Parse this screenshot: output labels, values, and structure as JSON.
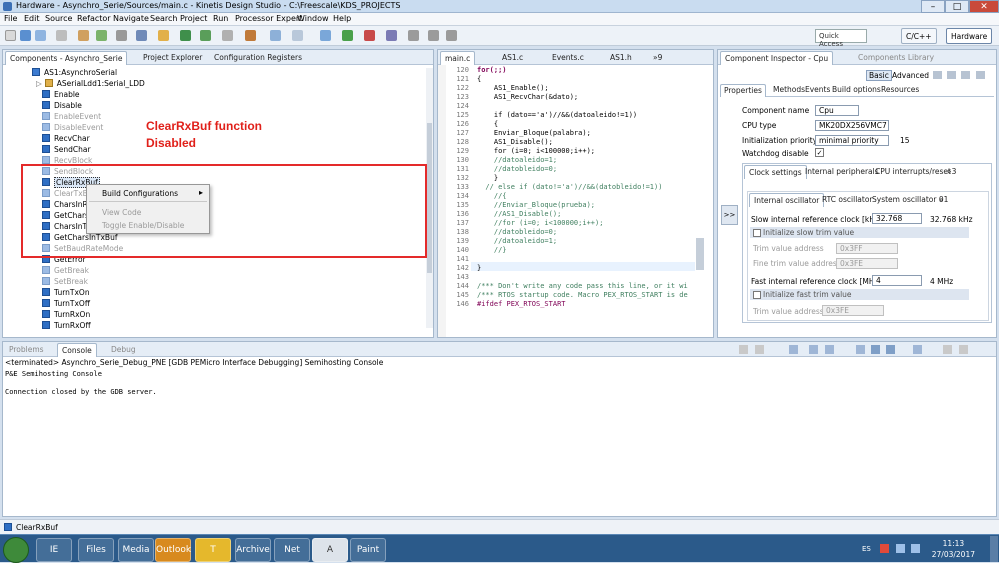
{
  "window": {
    "title": "Hardware - Asynchro_Serie/Sources/main.c - Kinetis Design Studio - C:\\Freescale\\KDS_PROJECTS",
    "min": "–",
    "max": "□",
    "close": "✕"
  },
  "menu": [
    "File",
    "Edit",
    "Source",
    "Refactor",
    "Navigate",
    "Search",
    "Project",
    "Run",
    "Processor Expert",
    "Window",
    "Help"
  ],
  "toolbar": {
    "quick_access": "Quick Access",
    "persp_cpp": "C/C++",
    "persp_hw": "Hardware"
  },
  "left_pane": {
    "tabs": [
      "Components - Asynchro_Serie",
      "Project Explorer",
      "Configuration Registers"
    ],
    "tree": [
      {
        "label": "AS1:AsynchroSerial",
        "state": "root"
      },
      {
        "label": "ASerialLdd1:Serial_LDD",
        "state": "child"
      },
      {
        "label": "Enable",
        "state": "on"
      },
      {
        "label": "Disable",
        "state": "on"
      },
      {
        "label": "EnableEvent",
        "state": "off"
      },
      {
        "label": "DisableEvent",
        "state": "off"
      },
      {
        "label": "RecvChar",
        "state": "on"
      },
      {
        "label": "SendChar",
        "state": "on"
      },
      {
        "label": "RecvBlock",
        "state": "off"
      },
      {
        "label": "SendBlock",
        "state": "off"
      },
      {
        "label": "ClearRxBuf",
        "state": "selected"
      },
      {
        "label": "ClearTxBuf",
        "state": "off"
      },
      {
        "label": "CharsInRxBuf",
        "state": "on"
      },
      {
        "label": "GetCharsInRxBuf",
        "state": "on"
      },
      {
        "label": "CharsInTxBuf",
        "state": "on"
      },
      {
        "label": "GetCharsInTxBuf",
        "state": "on"
      },
      {
        "label": "SetBaudRateMode",
        "state": "off"
      },
      {
        "label": "GetError",
        "state": "on"
      },
      {
        "label": "GetBreak",
        "state": "off"
      },
      {
        "label": "SetBreak",
        "state": "off"
      },
      {
        "label": "TurnTxOn",
        "state": "on"
      },
      {
        "label": "TurnTxOff",
        "state": "on"
      },
      {
        "label": "TurnRxOn",
        "state": "on"
      },
      {
        "label": "TurnRxOff",
        "state": "on"
      }
    ],
    "annotation_line1": "ClearRxBuf function",
    "annotation_line2": "Disabled",
    "context_menu": {
      "item1": "Build Configurations",
      "item1_arrow": "▸",
      "item2": "View Code",
      "item3": "Toggle Enable/Disable"
    }
  },
  "editor": {
    "tabs": [
      "main.c",
      "AS1.c",
      "Events.c",
      "AS1.h",
      "»9"
    ],
    "lines": [
      {
        "n": "120",
        "t": "for(;;)"
      },
      {
        "n": "121",
        "t": "{"
      },
      {
        "n": "122",
        "t": "    AS1_Enable();"
      },
      {
        "n": "123",
        "t": "    AS1_RecvChar(&dato);"
      },
      {
        "n": "124",
        "t": ""
      },
      {
        "n": "125",
        "t": "    if (dato=='a')//&&(datoaleido!=1))"
      },
      {
        "n": "126",
        "t": "    {"
      },
      {
        "n": "127",
        "t": "    Enviar_Bloque(palabra);"
      },
      {
        "n": "128",
        "t": "    AS1_Disable();"
      },
      {
        "n": "129",
        "t": "    for (i=0; i<100000;i++);"
      },
      {
        "n": "130",
        "t": "    //datoaleido=1;"
      },
      {
        "n": "131",
        "t": "    //datobleido=0;"
      },
      {
        "n": "132",
        "t": "    }"
      },
      {
        "n": "133",
        "t": "  // else if (dato!='a')//&&(datobleido!=1))"
      },
      {
        "n": "134",
        "t": "    //{"
      },
      {
        "n": "135",
        "t": "    //Enviar_Bloque(prueba);"
      },
      {
        "n": "136",
        "t": "    //AS1_Disable();"
      },
      {
        "n": "137",
        "t": "    //for (i=0; i<100000;i++);"
      },
      {
        "n": "138",
        "t": "    //datobleido=0;"
      },
      {
        "n": "139",
        "t": "    //datoaleido=1;"
      },
      {
        "n": "140",
        "t": "    //}"
      },
      {
        "n": "141",
        "t": ""
      },
      {
        "n": "142",
        "t": "}"
      },
      {
        "n": "143",
        "t": ""
      },
      {
        "n": "144",
        "t": "/*** Don't write any code pass this line, or it wi"
      },
      {
        "n": "145",
        "t": "/*** RTOS startup code. Macro PEX_RTOS_START is de"
      },
      {
        "n": "146",
        "t": "#ifdef PEX_RTOS_START"
      }
    ]
  },
  "inspector": {
    "tabs": [
      "Component Inspector - Cpu",
      "Components Library"
    ],
    "mode_basic": "Basic",
    "mode_advanced": "Advanced",
    "subtabs": [
      "Properties",
      "Methods",
      "Events",
      "Build options",
      "Resources"
    ],
    "component_name_label": "Component name",
    "component_name": "Cpu",
    "cpu_type_label": "CPU type",
    "cpu_type": "MK20DX256VMC7",
    "init_priority_label": "Initialization priority",
    "init_priority": "minimal priority",
    "init_priority_num": "15",
    "watchdog_label": "Watchdog disable",
    "watchdog_check": "✓",
    "settings_tabs": [
      "Clock settings",
      "Internal peripherals",
      "CPU interrupts/reset",
      "»3"
    ],
    "osc_tabs": [
      "Internal oscillator",
      "RTC oscillator",
      "System oscillator 0",
      "»1"
    ],
    "expand_btn": ">>",
    "slow_clock_label": "Slow internal reference clock [kHz]",
    "slow_clock_value": "32.768",
    "slow_clock_khz": "32.768 kHz",
    "init_slow_trim": "Initialize slow trim value",
    "trim_addr_label": "Trim value address",
    "trim_addr": "0x3FF",
    "fine_trim_label": "Fine trim value address",
    "fine_trim": "0x3FE",
    "fast_clock_label": "Fast internal reference clock [MHz]",
    "fast_clock_value": "4",
    "fast_clock_mhz": "4 MHz",
    "init_fast_trim": "Initialize fast trim value",
    "trim_addr2_label": "Trim value address",
    "trim_addr2": "0x3FE"
  },
  "console": {
    "tabs": [
      "Problems",
      "Console",
      "Debug"
    ],
    "header": "<terminated> Asynchro_Serie_Debug_PNE [GDB PEMicro Interface Debugging] Semihosting Console",
    "line1": "P&E Semihosting Console",
    "line2": "Connection closed by the GDB server."
  },
  "status": {
    "selected": "ClearRxBuf"
  },
  "taskbar": {
    "lang": "ES",
    "time": "11:13",
    "date": "27/03/2017",
    "apps": [
      "IE",
      "Files",
      "Media",
      "Outlook",
      "T",
      "Archive",
      "Net",
      "A",
      "Paint"
    ]
  }
}
